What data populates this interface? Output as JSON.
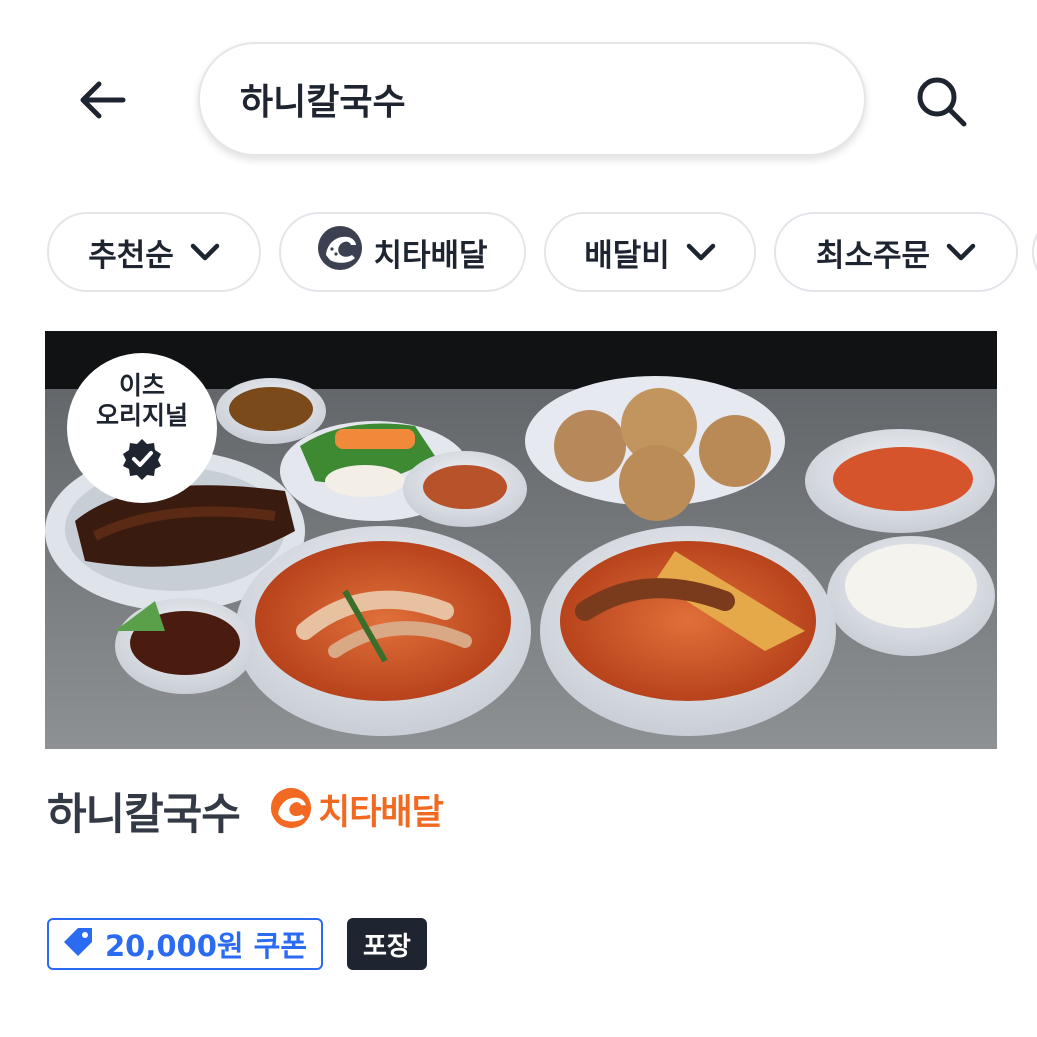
{
  "header": {
    "search_value": "하니칼국수"
  },
  "filters": [
    {
      "label": "추천순",
      "has_dropdown": true
    },
    {
      "label": "치타배달",
      "has_icon": "cheetah-icon"
    },
    {
      "label": "배달비",
      "has_dropdown": true
    },
    {
      "label": "최소주문",
      "has_dropdown": true
    }
  ],
  "restaurant": {
    "badge_line1": "이츠",
    "badge_line2": "오리지널",
    "name": "하니칼국수",
    "delivery_tag": "치타배달",
    "coupon": "20,000원 쿠폰",
    "pickup": "포장"
  },
  "colors": {
    "accent_blue": "#2a6bf2",
    "cheetah_orange": "#f26a21",
    "dark": "#1f2530"
  }
}
